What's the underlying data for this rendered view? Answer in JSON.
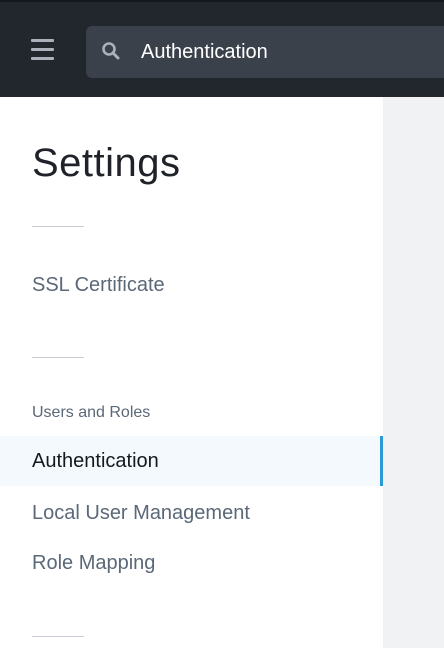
{
  "header": {
    "menu_icon": "hamburger-menu-icon",
    "search": {
      "icon": "search-icon",
      "value": "Authentication"
    }
  },
  "sidebar": {
    "title": "Settings",
    "items": [
      {
        "label": "SSL Certificate",
        "active": false
      },
      {
        "label": "Authentication",
        "active": true
      },
      {
        "label": "Local User Management",
        "active": false
      },
      {
        "label": "Role Mapping",
        "active": false
      }
    ],
    "sections": [
      {
        "label": "Users and Roles"
      }
    ]
  },
  "colors": {
    "topbar": "#22272e",
    "search_bg": "#3a414b",
    "active_indicator": "#2b9ad6",
    "active_bg": "#f4f9fd",
    "content_bg": "#f1f2f4"
  }
}
